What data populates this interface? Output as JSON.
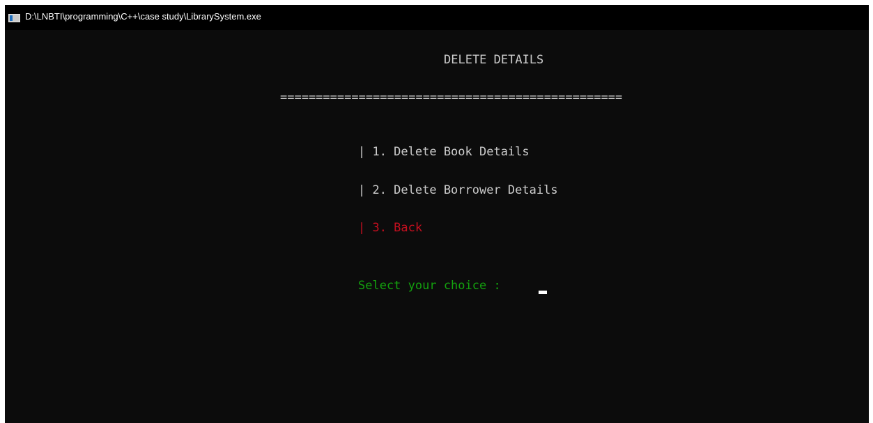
{
  "window": {
    "title": "D:\\LNBTI\\programming\\C++\\case study\\LibrarySystem.exe",
    "icon": "console-app-icon"
  },
  "console": {
    "heading": "DELETE DETAILS",
    "separator": "================================================",
    "menu_items": [
      {
        "label": "| 1. Delete Book Details"
      },
      {
        "label": "| 2. Delete Borrower Details"
      },
      {
        "label": "| 3. Back"
      }
    ],
    "prompt": "Select your choice : "
  },
  "colors": {
    "background": "#0c0c0c",
    "text": "#cccccc",
    "back_option": "#c50f1f",
    "prompt": "#13a10e",
    "cursor": "#ffffff"
  }
}
